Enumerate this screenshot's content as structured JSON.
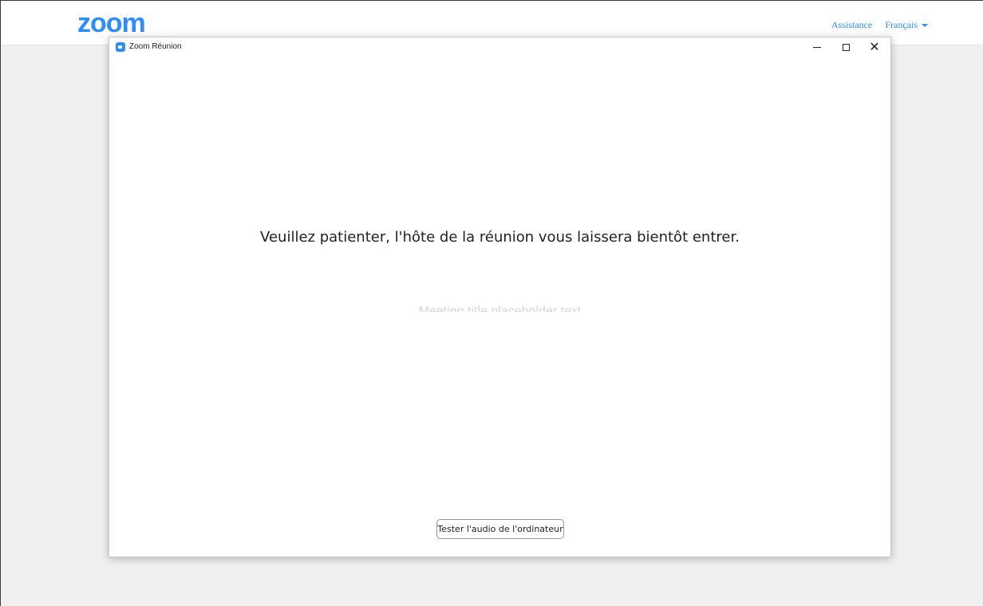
{
  "header": {
    "logo_text": "zoom",
    "support_label": "Assistance",
    "language_label": "Français"
  },
  "dialog": {
    "title": "Zoom Réunion",
    "message": "Veuillez patienter, l'hôte de la réunion vous laissera bientôt entrer.",
    "faded_text": "Meeting title placeholder text",
    "test_audio_label": "Tester l'audio de l'ordinateur"
  },
  "icons": {
    "app": "zoom-app-icon",
    "minimize": "minimize-icon",
    "maximize": "maximize-icon",
    "close": "close-icon",
    "language_caret": "caret-down-icon"
  },
  "colors": {
    "brand": "#2d8cff",
    "background": "#f0f0f0"
  }
}
